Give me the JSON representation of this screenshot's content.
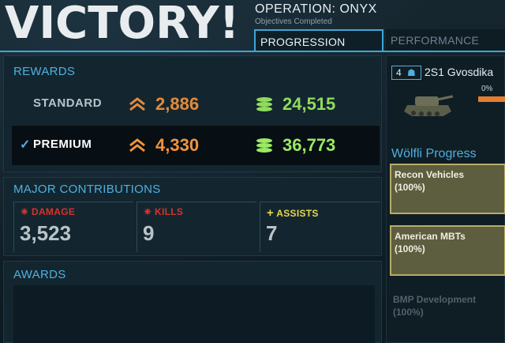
{
  "header": {
    "title": "VICTORY!",
    "operation": "OPERATION: ONYX",
    "operation_sub": "Objectives Completed"
  },
  "tabs": [
    {
      "label": "PROGRESSION",
      "active": true
    },
    {
      "label": "PERFORMANCE",
      "active": false
    }
  ],
  "rewards": {
    "title": "REWARDS",
    "rows": [
      {
        "label": "STANDARD",
        "xp": "2,886",
        "credits": "24,515",
        "selected": false
      },
      {
        "label": "PREMIUM",
        "xp": "4,330",
        "credits": "36,773",
        "selected": true
      }
    ]
  },
  "contributions": {
    "title": "MAJOR CONTRIBUTIONS",
    "stats": [
      {
        "label": "DAMAGE",
        "value": "3,523",
        "color": "#d4332b",
        "icon": "tank-damage-icon"
      },
      {
        "label": "KILLS",
        "value": "9",
        "color": "#d4332b",
        "icon": "tank-kill-icon"
      },
      {
        "label": "ASSISTS",
        "value": "7",
        "color": "#e8d84a",
        "icon": "plus-icon"
      }
    ]
  },
  "awards": {
    "title": "AWARDS"
  },
  "vehicle": {
    "tier": "4",
    "name": "2S1 Gvosdika",
    "progress_text": "0%",
    "progress_value": 0
  },
  "progress": {
    "title": "Wölfli Progress",
    "items": [
      {
        "name": "Recon Vehicles",
        "pct": "(100%)",
        "highlighted": true
      },
      {
        "name": "American MBTs",
        "pct": "(100%)",
        "highlighted": true
      },
      {
        "name": "BMP Development",
        "pct": "(100%)",
        "highlighted": false
      }
    ]
  },
  "colors": {
    "accent": "#4fb0de",
    "xp": "#e48a3a",
    "credits": "#8fdc5c"
  }
}
